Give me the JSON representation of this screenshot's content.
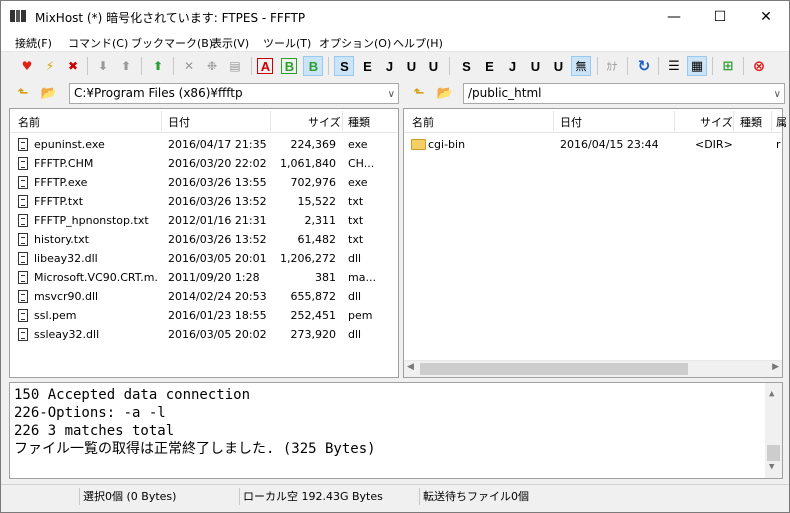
{
  "window": {
    "title": "MixHost (*) 暗号化されています: FTPES - FFFTP"
  },
  "caption_buttons": {
    "minimize": "—",
    "maximize": "☐",
    "close": "✕"
  },
  "menu": [
    "接続(F)",
    "コマンド(C)",
    "ブックマーク(B)",
    "表示(V)",
    "ツール(T)",
    "オプション(O)",
    "ヘルプ(H)"
  ],
  "toolbar": {
    "ascii": "A",
    "binary": "B",
    "auto": "B",
    "sj": "S",
    "euc": "E",
    "jis": "J",
    "utf8n": "U",
    "utf8": "U",
    "sj2": "S",
    "euc2": "E",
    "jis2": "J",
    "utf8n2": "U",
    "utf8_2": "U",
    "none": "無",
    "kana": "ｶﾅ"
  },
  "local": {
    "path": "C:¥Program Files (x86)¥ffftp",
    "columns": {
      "name": "名前",
      "date": "日付",
      "size": "サイズ",
      "type": "種類"
    },
    "files": [
      {
        "name": "epuninst.exe",
        "date": "2016/04/17 21:35",
        "size": "224,369",
        "type": "exe"
      },
      {
        "name": "FFFTP.CHM",
        "date": "2016/03/20 22:02",
        "size": "1,061,840",
        "type": "CH..."
      },
      {
        "name": "FFFTP.exe",
        "date": "2016/03/26 13:55",
        "size": "702,976",
        "type": "exe"
      },
      {
        "name": "FFFTP.txt",
        "date": "2016/03/26 13:52",
        "size": "15,522",
        "type": "txt"
      },
      {
        "name": "FFFTP_hpnonstop.txt",
        "date": "2012/01/16 21:31",
        "size": "2,311",
        "type": "txt"
      },
      {
        "name": "history.txt",
        "date": "2016/03/26 13:52",
        "size": "61,482",
        "type": "txt"
      },
      {
        "name": "libeay32.dll",
        "date": "2016/03/05 20:01",
        "size": "1,206,272",
        "type": "dll"
      },
      {
        "name": "Microsoft.VC90.CRT.m...",
        "date": "2011/09/20  1:28",
        "size": "381",
        "type": "ma..."
      },
      {
        "name": "msvcr90.dll",
        "date": "2014/02/24 20:53",
        "size": "655,872",
        "type": "dll"
      },
      {
        "name": "ssl.pem",
        "date": "2016/01/23 18:55",
        "size": "252,451",
        "type": "pem"
      },
      {
        "name": "ssleay32.dll",
        "date": "2016/03/05 20:02",
        "size": "273,920",
        "type": "dll"
      }
    ]
  },
  "remote": {
    "path": "/public_html",
    "columns": {
      "name": "名前",
      "date": "日付",
      "size": "サイズ",
      "type": "種類",
      "attr": "属"
    },
    "files": [
      {
        "name": "cgi-bin",
        "date": "2016/04/15 23:44",
        "size": "<DIR>",
        "type": "",
        "attr": "r"
      }
    ]
  },
  "log": [
    "150 Accepted data connection",
    "226-Options: -a -l",
    "226 3 matches total",
    "ファイル一覧の取得は正常終了しました. (325 Bytes)"
  ],
  "status": {
    "selected": "選択0個 (0 Bytes)",
    "local_free": "ローカル空 192.43G Bytes",
    "queue": "転送待ちファイル0個"
  },
  "colors": {
    "accent_pressed": "#cce4f7",
    "folder": "#f3cf64",
    "error_red": "#e0201b",
    "green": "#2e9e2e"
  }
}
